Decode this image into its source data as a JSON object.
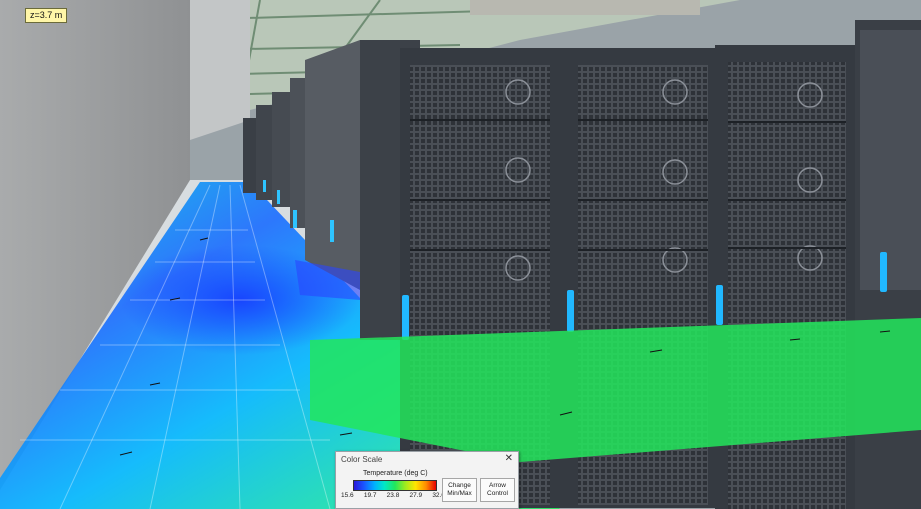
{
  "viewport": {
    "z_label": "z=3.7 m"
  },
  "color_scale_dialog": {
    "title": "Color Scale",
    "close_glyph": "✕",
    "scale_title": "Temperature (deg C)",
    "ticks": [
      "15.6",
      "19.7",
      "23.8",
      "27.9",
      "32.0"
    ],
    "change_minmax_label": "Change Min/Max",
    "arrow_control_label": "Arrow Control"
  },
  "colors": {
    "cold": "#1a55ff",
    "cool": "#00c8ff",
    "mid": "#22e65c",
    "warm": "#ffe600",
    "hot": "#e60000"
  }
}
